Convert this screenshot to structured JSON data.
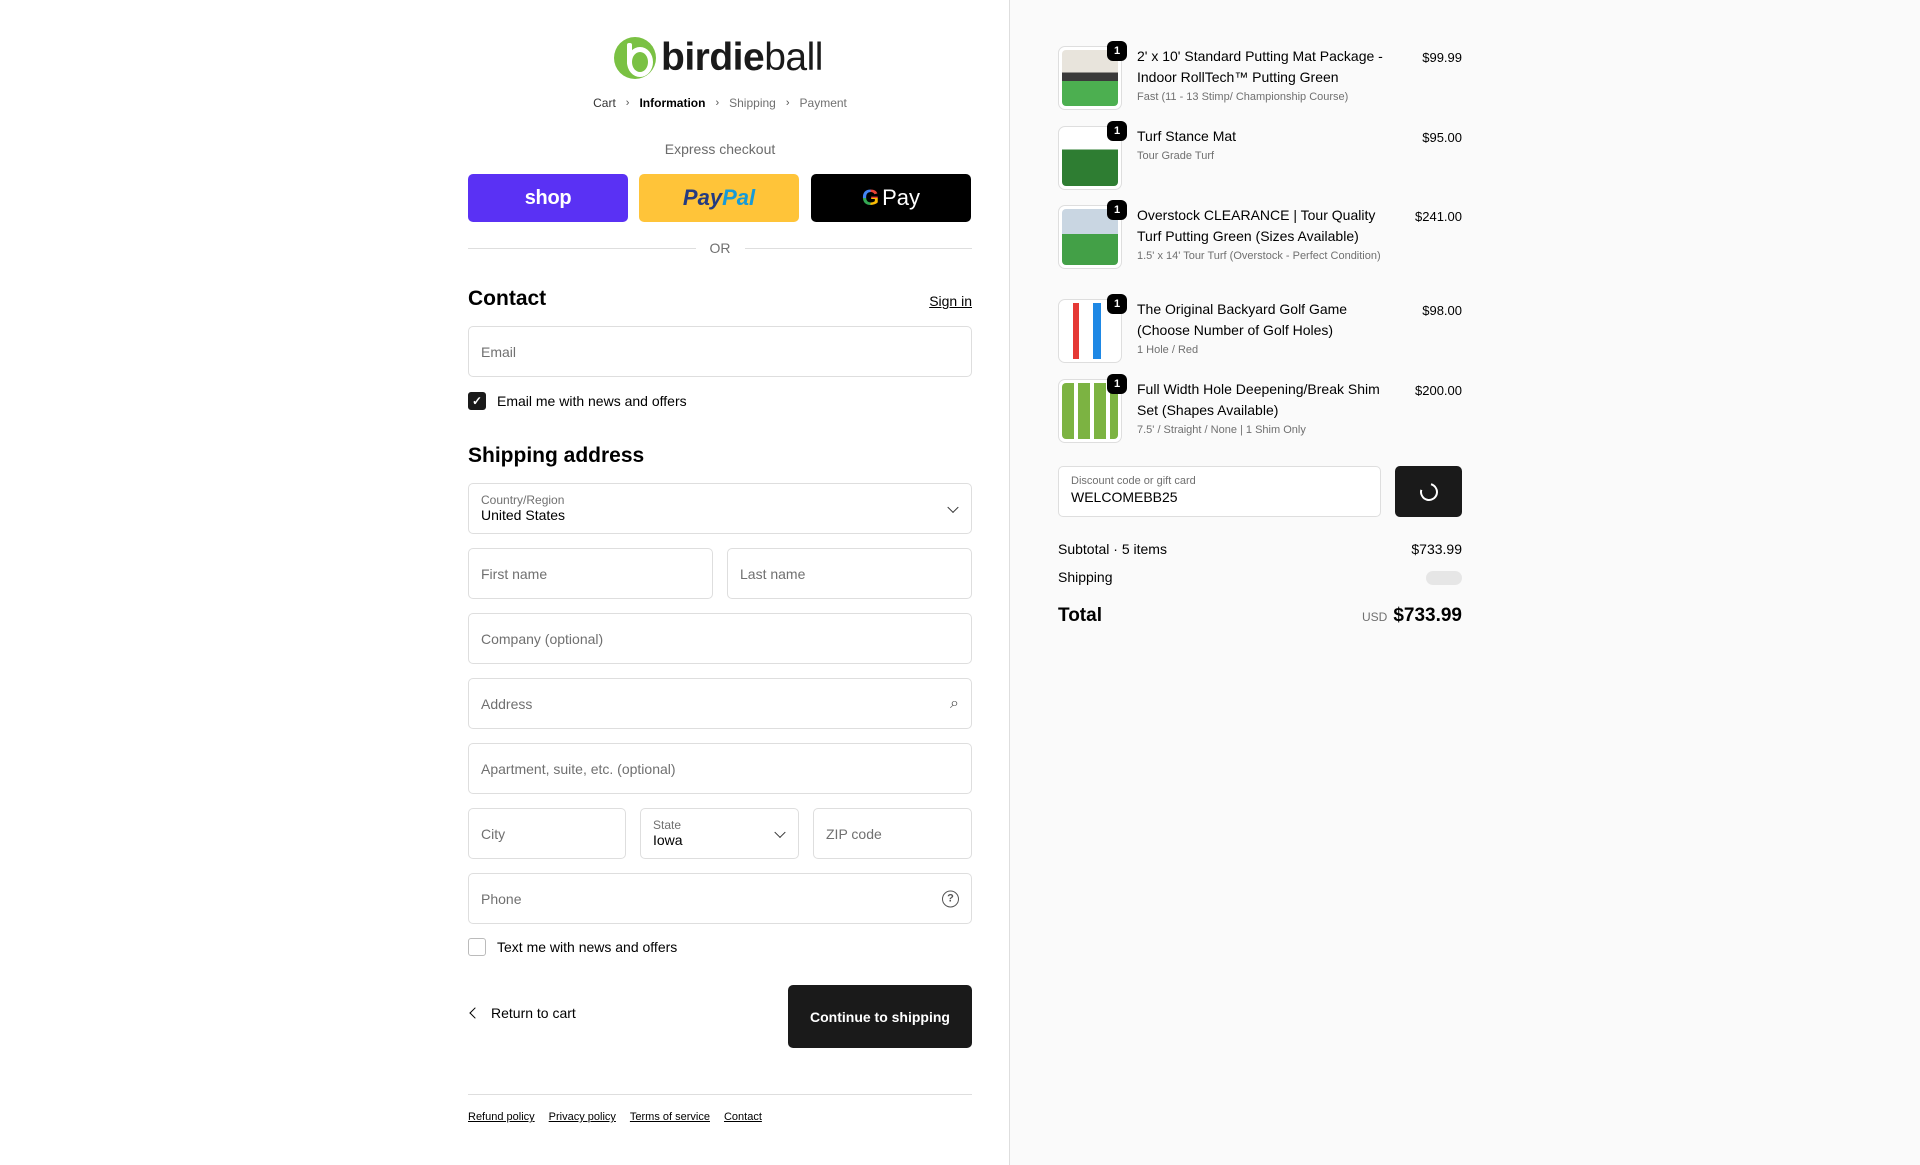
{
  "brand": {
    "name_bold": "birdie",
    "name_light": "ball"
  },
  "breadcrumb": [
    "Cart",
    "Information",
    "Shipping",
    "Payment"
  ],
  "express": {
    "label": "Express checkout",
    "shop": "shop",
    "paypal_a": "Pay",
    "paypal_b": "Pal",
    "gpay_g": "G",
    "gpay_text": "Pay",
    "or": "OR"
  },
  "contact": {
    "title": "Contact",
    "sign_in": "Sign in",
    "email_placeholder": "Email",
    "news_checkbox": "Email me with news and offers",
    "news_checked": true
  },
  "shipping": {
    "title": "Shipping address",
    "country_label": "Country/Region",
    "country_value": "United States",
    "first_name": "First name",
    "last_name": "Last name",
    "company": "Company (optional)",
    "address": "Address",
    "apartment": "Apartment, suite, etc. (optional)",
    "city": "City",
    "state_label": "State",
    "state_value": "Iowa",
    "zip": "ZIP code",
    "phone": "Phone",
    "sms_checkbox": "Text me with news and offers",
    "sms_checked": false
  },
  "actions": {
    "return": "Return to cart",
    "continue": "Continue to shipping"
  },
  "footer": [
    "Refund policy",
    "Privacy policy",
    "Terms of service",
    "Contact"
  ],
  "order": {
    "items": [
      {
        "qty": "1",
        "name": "2' x 10' Standard Putting Mat Package - Indoor RollTech™ Putting Green",
        "variant": "Fast (11 - 13 Stimp/ Championship Course)",
        "price": "$99.99"
      },
      {
        "qty": "1",
        "name": "Turf Stance Mat",
        "variant": "Tour Grade Turf",
        "price": "$95.00"
      },
      {
        "qty": "1",
        "name": "Overstock CLEARANCE | Tour Quality Turf Putting Green (Sizes Available)",
        "variant": "1.5' x 14' Tour Turf (Overstock - Perfect Condition)",
        "price": "$241.00"
      },
      {
        "qty": "1",
        "name": "The Original Backyard Golf Game (Choose Number of Golf Holes)",
        "variant": "1 Hole / Red",
        "price": "$98.00"
      },
      {
        "qty": "1",
        "name": "Full Width Hole Deepening/Break Shim Set (Shapes Available)",
        "variant": "7.5' / Straight / None | 1 Shim Only",
        "price": "$200.00"
      }
    ],
    "discount_label": "Discount code or gift card",
    "discount_value": "WELCOMEBB25",
    "subtotal_label": "Subtotal · 5 items",
    "subtotal_value": "$733.99",
    "shipping_label": "Shipping",
    "total_label": "Total",
    "currency": "USD",
    "total_value": "$733.99"
  },
  "colors": {
    "shop": "#5a31f4",
    "paypal": "#ffc439",
    "gpay": "#000000",
    "brand_green": "#7ac143",
    "primary_button": "#1a1a1a"
  }
}
